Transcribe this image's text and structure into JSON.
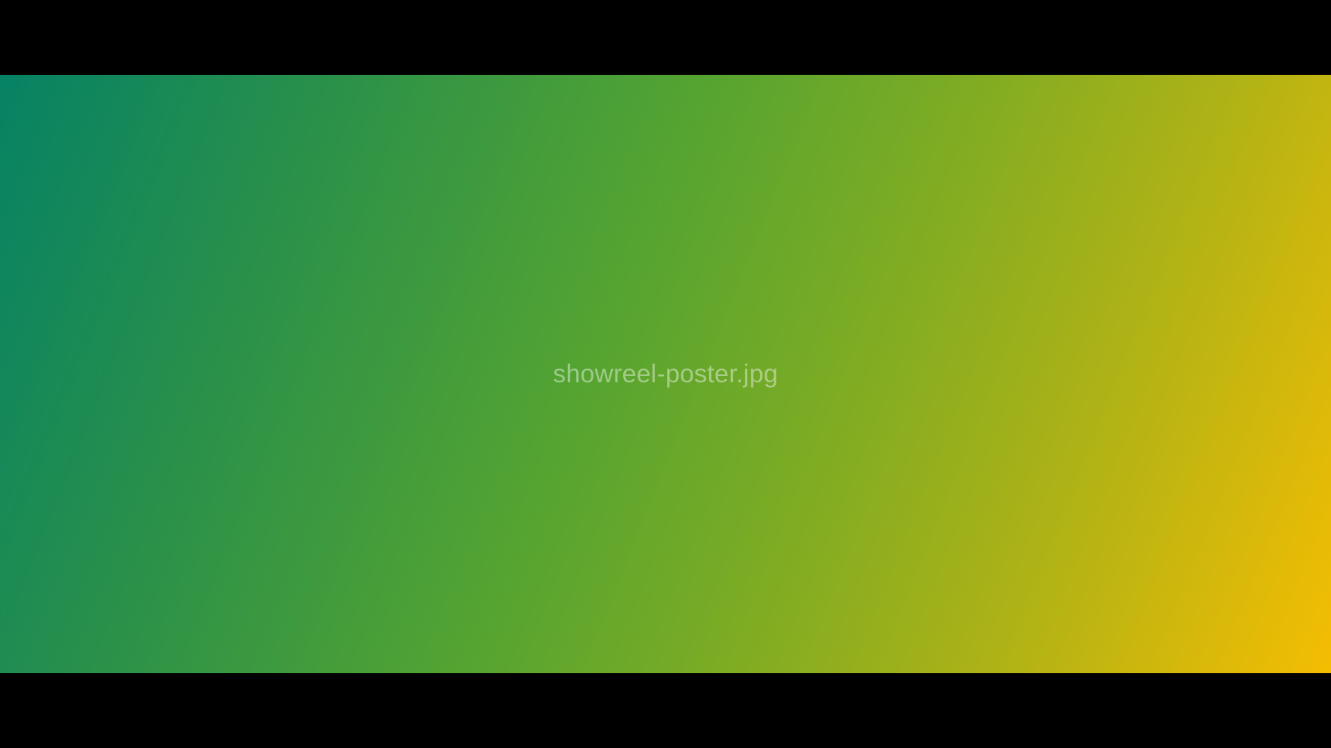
{
  "viewer": {
    "filename": "showreel-poster.jpg"
  },
  "colors": {
    "letterbox": "#000000",
    "gradient_start": "#068264",
    "gradient_mid": "#55a431",
    "gradient_end": "#f5bd02",
    "filename_text": "rgba(255,255,255,0.42)"
  }
}
